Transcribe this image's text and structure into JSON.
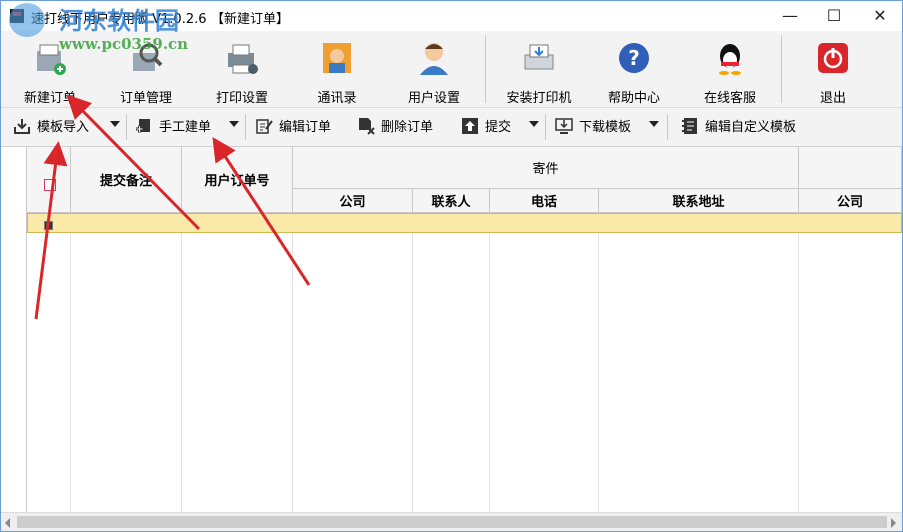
{
  "window": {
    "title": "速打线下用户专用版 V1.0.2.6",
    "subtitle": "【新建订单】",
    "minimize": "—",
    "maximize": "☐",
    "close": "✕"
  },
  "watermark": {
    "line1": "河东软件园",
    "line2": "www.pc0359.cn"
  },
  "ribbon": [
    {
      "label": "新建订单",
      "icon": "new-order-icon"
    },
    {
      "label": "订单管理",
      "icon": "search-order-icon"
    },
    {
      "label": "打印设置",
      "icon": "printer-settings-icon"
    },
    {
      "label": "通讯录",
      "icon": "contacts-icon"
    },
    {
      "label": "用户设置",
      "icon": "user-icon"
    },
    {
      "label": "安装打印机",
      "icon": "install-printer-icon"
    },
    {
      "label": "帮助中心",
      "icon": "help-icon"
    },
    {
      "label": "在线客服",
      "icon": "qq-icon"
    },
    {
      "label": "退出",
      "icon": "power-icon"
    }
  ],
  "toolbar": {
    "import": "模板导入",
    "manual": "手工建单",
    "edit": "编辑订单",
    "delete": "删除订单",
    "submit": "提交",
    "download": "下载模板",
    "custom": "编辑自定义模板"
  },
  "grid": {
    "col_note": "提交备注",
    "col_order_no": "用户订单号",
    "group_sender": "寄件",
    "col_company": "公司",
    "col_contact": "联系人",
    "col_phone": "电话",
    "col_address": "联系地址",
    "col_company2": "公司"
  },
  "colors": {
    "accent_blue": "#2f7fd6",
    "selected_row": "#fbe9a9",
    "annotation_arrow": "#d9262b"
  }
}
